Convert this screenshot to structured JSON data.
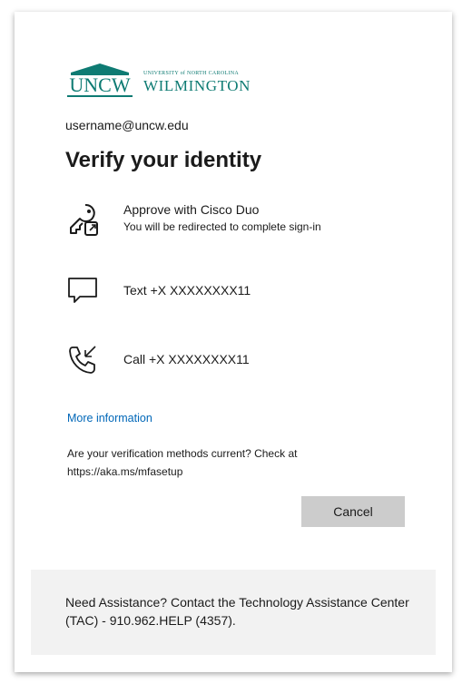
{
  "logo": {
    "abbrev": "UNCW",
    "small_text": "UNIVERSITY of NORTH CAROLINA",
    "name": "WILMINGTON"
  },
  "username": "username@uncw.edu",
  "title": "Verify your identity",
  "options": [
    {
      "icon": "key-phone-icon",
      "main": "Approve with Cisco Duo",
      "sub": "You will be redirected to complete sign-in"
    },
    {
      "icon": "message-icon",
      "main": "Text +X XXXXXXXX11"
    },
    {
      "icon": "phone-call-icon",
      "main": "Call +X XXXXXXXX11"
    }
  ],
  "more_info_link": "More information",
  "methods_text": "Are your verification methods current? Check at https://aka.ms/mfasetup",
  "cancel_label": "Cancel",
  "footer_text": "Need Assistance? Contact the Technology Assistance Center (TAC) - 910.962.HELP (4357).",
  "colors": {
    "brand_teal": "#0e7b73",
    "link": "#0067b8",
    "button_gray": "#cccccc",
    "footer_bg": "#f2f2f2"
  }
}
